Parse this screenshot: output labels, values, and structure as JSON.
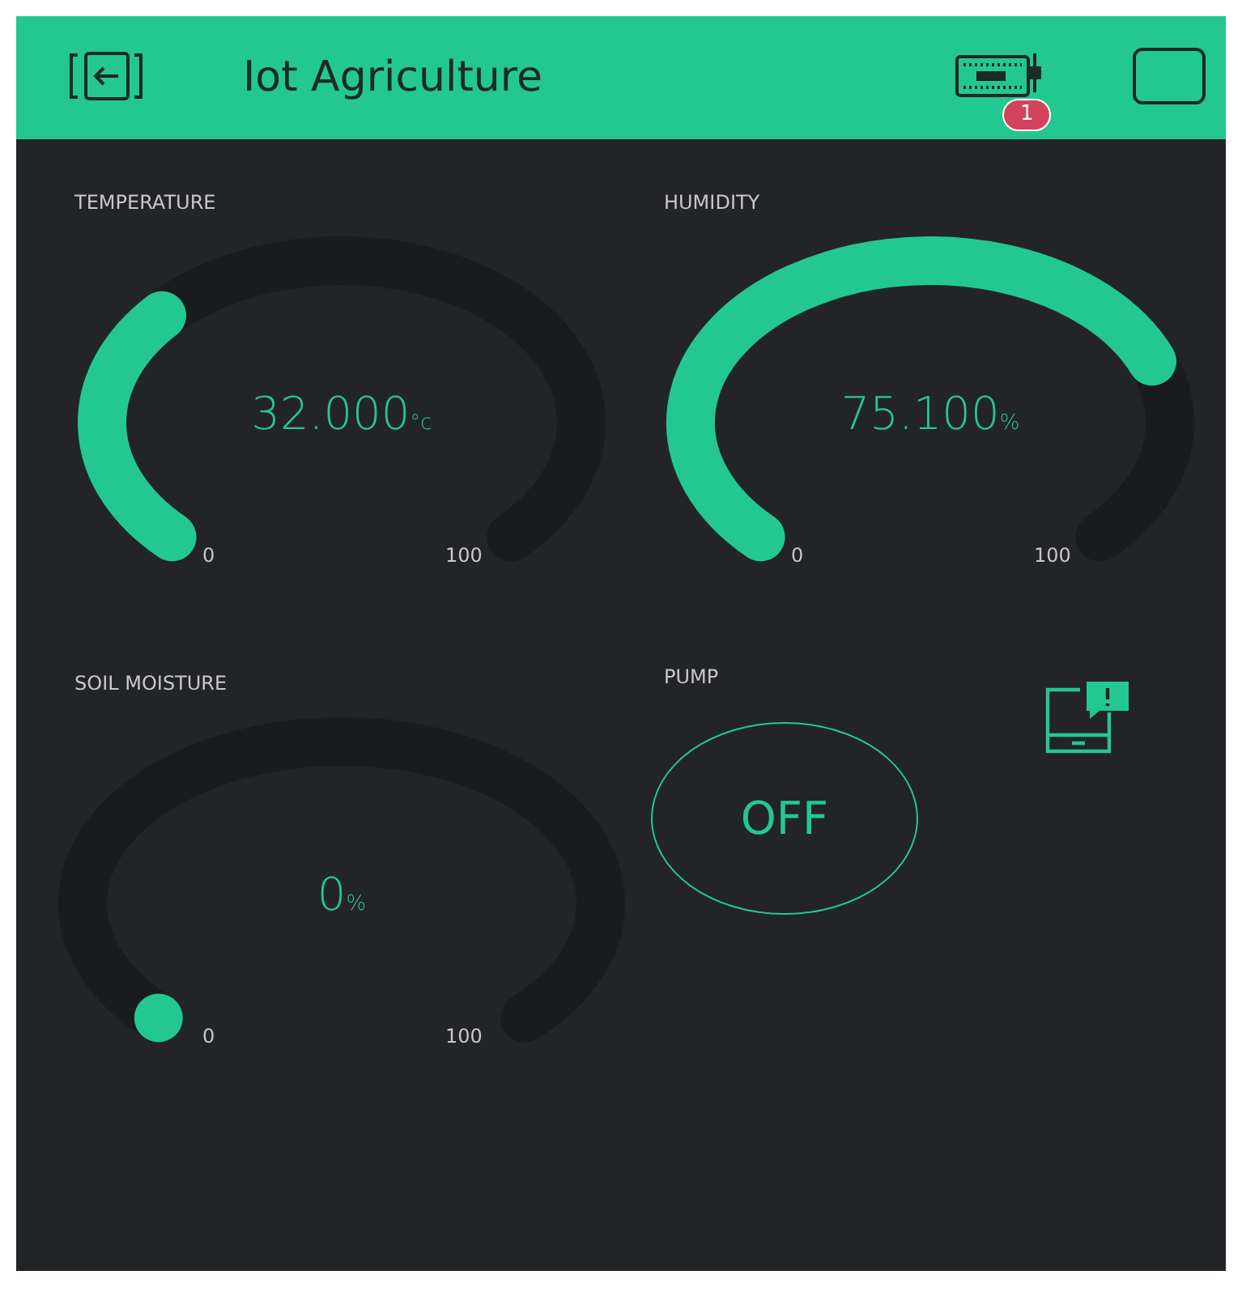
{
  "header": {
    "title": "Iot Agriculture",
    "device_badge": "1"
  },
  "gauges": [
    {
      "label": "TEMPERATURE",
      "value": "32.000",
      "unit": "°c",
      "min": "0",
      "max": "100"
    },
    {
      "label": "HUMIDITY",
      "value": "75.100",
      "unit": "%",
      "min": "0",
      "max": "100"
    },
    {
      "label": "SOIL MOISTURE",
      "value": "0",
      "unit": "%",
      "min": "0",
      "max": "100"
    }
  ],
  "pump": {
    "label": "PUMP",
    "button": "OFF",
    "on": false
  }
}
